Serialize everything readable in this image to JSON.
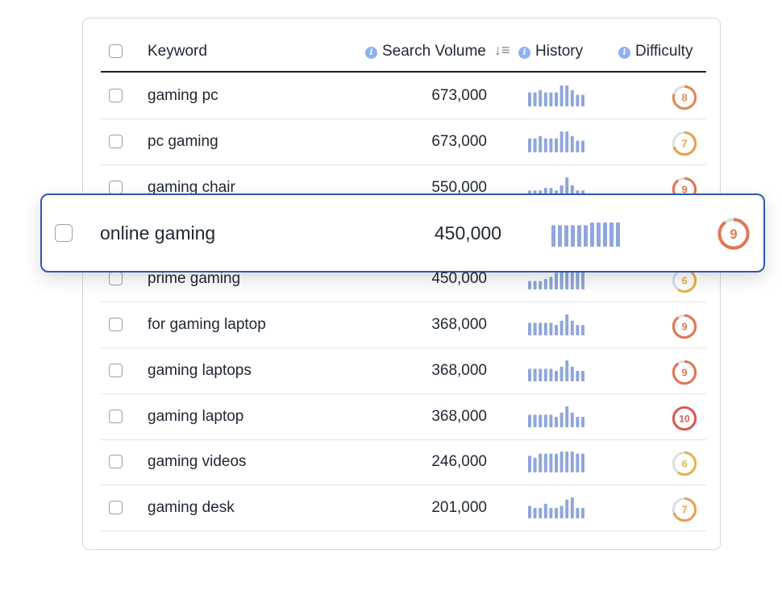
{
  "header": {
    "keyword": "Keyword",
    "search_volume": "Search Volume",
    "history": "History",
    "difficulty": "Difficulty",
    "info_glyph": "i",
    "sort_glyph": "↓≡"
  },
  "colors": {
    "accent": "#2f57b8",
    "bar": "#8fa6dd",
    "info": "#8fb0f2",
    "difficulty": {
      "6": "#e8b24a",
      "7": "#eba04b",
      "8": "#e7874f",
      "9": "#e27652",
      "10": "#db5a55"
    }
  },
  "rows": [
    {
      "keyword": "gaming pc",
      "volume": "673,000",
      "difficulty": 8,
      "history": [
        6,
        6,
        7,
        6,
        6,
        6,
        9,
        9,
        7,
        5,
        5
      ]
    },
    {
      "keyword": "pc gaming",
      "volume": "673,000",
      "difficulty": 7,
      "history": [
        6,
        6,
        7,
        6,
        6,
        6,
        9,
        9,
        7,
        5,
        5
      ]
    },
    {
      "keyword": "gaming chair",
      "volume": "550,000",
      "difficulty": 9,
      "history": [
        3,
        3,
        3,
        4,
        4,
        3,
        5,
        8,
        5,
        3,
        3
      ]
    },
    {
      "keyword": "online gaming",
      "volume": "450,000",
      "difficulty": 9,
      "history": [
        8,
        8,
        8,
        8,
        8,
        8,
        9,
        9,
        9,
        9,
        9
      ]
    },
    {
      "keyword": "prime gaming",
      "volume": "450,000",
      "difficulty": 6,
      "history": [
        4,
        4,
        4,
        5,
        6,
        8,
        9,
        10,
        10,
        10,
        10
      ]
    },
    {
      "keyword": "for gaming laptop",
      "volume": "368,000",
      "difficulty": 9,
      "history": [
        6,
        6,
        6,
        6,
        6,
        5,
        7,
        10,
        7,
        5,
        5
      ]
    },
    {
      "keyword": "gaming laptops",
      "volume": "368,000",
      "difficulty": 9,
      "history": [
        6,
        6,
        6,
        6,
        6,
        5,
        7,
        10,
        7,
        5,
        5
      ]
    },
    {
      "keyword": "gaming laptop",
      "volume": "368,000",
      "difficulty": 10,
      "history": [
        6,
        6,
        6,
        6,
        6,
        5,
        7,
        10,
        7,
        5,
        5
      ]
    },
    {
      "keyword": "gaming videos",
      "volume": "246,000",
      "difficulty": 6,
      "history": [
        8,
        7,
        9,
        9,
        9,
        9,
        10,
        10,
        10,
        9,
        9
      ]
    },
    {
      "keyword": "gaming desk",
      "volume": "201,000",
      "difficulty": 7,
      "history": [
        6,
        5,
        5,
        7,
        5,
        5,
        6,
        9,
        10,
        5,
        5
      ]
    }
  ],
  "highlight": {
    "keyword": "online gaming",
    "volume": "450,000",
    "difficulty": 9,
    "history": [
      8,
      8,
      8,
      8,
      8,
      8,
      9,
      9,
      9,
      9,
      9
    ]
  }
}
